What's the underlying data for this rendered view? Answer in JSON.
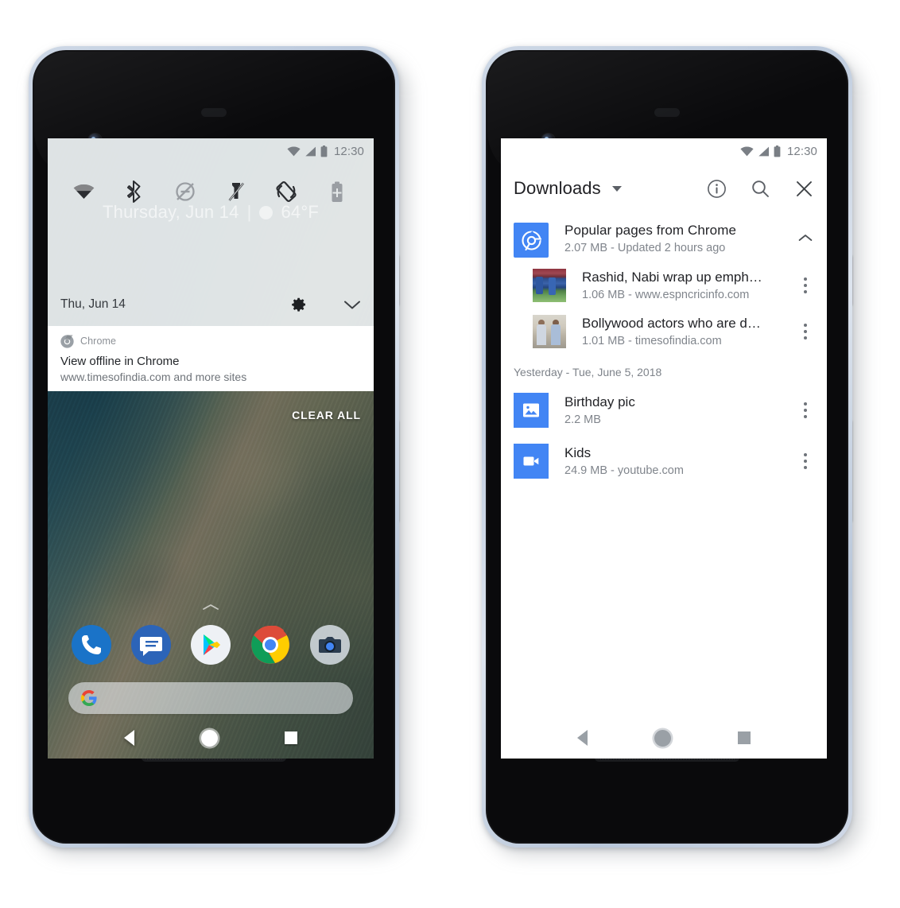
{
  "colors": {
    "accent_blue": "#4285f4",
    "chrome_tile_blue": "#4285f4",
    "status_gray": "#7a7f85",
    "power_button_teal": "#3ec7a6",
    "shade_gray": "#e5e9ea",
    "text_primary": "#222327",
    "text_secondary": "#80858c"
  },
  "left_phone": {
    "status_bar": {
      "time": "12:30",
      "icons": [
        "wifi-icon",
        "signal-icon",
        "battery-icon"
      ]
    },
    "quick_settings": {
      "tiles": [
        {
          "name": "wifi-tile",
          "icon": "wifi-icon",
          "state": "on"
        },
        {
          "name": "bluetooth-tile",
          "icon": "bluetooth-icon",
          "state": "on"
        },
        {
          "name": "do-not-disturb-tile",
          "icon": "do-not-disturb-off-icon",
          "state": "off"
        },
        {
          "name": "flashlight-tile",
          "icon": "flashlight-off-icon",
          "state": "off"
        },
        {
          "name": "auto-rotate-tile",
          "icon": "auto-rotate-icon",
          "state": "on"
        },
        {
          "name": "battery-saver-tile",
          "icon": "battery-saver-icon",
          "state": "off"
        }
      ],
      "date": "Thu, Jun 14",
      "settings_icon": "gear-icon",
      "expand_icon": "chevron-down-icon"
    },
    "widget_ghost": {
      "date": "Thursday, Jun 14",
      "separator": "|",
      "temperature": "64°F",
      "weather_icon": "sun-icon"
    },
    "notification": {
      "app_name": "Chrome",
      "app_icon": "chrome-icon",
      "title": "View offline in Chrome",
      "subtitle": "www.timesofindia.com and more sites"
    },
    "clear_all_label": "CLEAR ALL",
    "dock": [
      {
        "name": "phone-app-icon",
        "label": "Phone"
      },
      {
        "name": "messages-app-icon",
        "label": "Messages"
      },
      {
        "name": "play-store-app-icon",
        "label": "Play Store"
      },
      {
        "name": "chrome-app-icon",
        "label": "Chrome"
      },
      {
        "name": "camera-app-icon",
        "label": "Camera"
      }
    ],
    "search_bar": {
      "icon": "google-g-icon",
      "placeholder": ""
    },
    "nav_bar": {
      "back": "back-icon",
      "home": "home-icon",
      "recents": "recents-icon"
    }
  },
  "right_phone": {
    "status_bar": {
      "time": "12:30",
      "icons": [
        "wifi-icon",
        "signal-icon",
        "battery-icon"
      ]
    },
    "app_bar": {
      "title": "Downloads",
      "dropdown_icon": "caret-down-icon",
      "actions": [
        {
          "name": "info-button",
          "icon": "info-icon"
        },
        {
          "name": "search-button",
          "icon": "search-icon"
        },
        {
          "name": "close-button",
          "icon": "close-icon"
        }
      ]
    },
    "group": {
      "icon": "chrome-icon",
      "title": "Popular pages from Chrome",
      "subtitle": "2.07 MB - Updated 2 hours ago",
      "collapse_icon": "chevron-up-icon",
      "items": [
        {
          "thumbnail": "cricket-match-thumbnail",
          "title": "Rashid, Nabi wrap up emph…",
          "subtitle": "1.06 MB - www.espncricinfo.com",
          "menu_icon": "kebab-menu-icon"
        },
        {
          "thumbnail": "handshake-photo-thumbnail",
          "title": "Bollywood actors who are d…",
          "subtitle": "1.01 MB - timesofindia.com",
          "menu_icon": "kebab-menu-icon"
        }
      ]
    },
    "date_header": "Yesterday - Tue, June 5, 2018",
    "files": [
      {
        "icon": "image-file-icon",
        "title": "Birthday pic",
        "subtitle": "2.2 MB",
        "menu_icon": "kebab-menu-icon"
      },
      {
        "icon": "video-file-icon",
        "title": "Kids",
        "subtitle": "24.9 MB - youtube.com",
        "menu_icon": "kebab-menu-icon"
      }
    ],
    "nav_bar": {
      "back": "back-icon",
      "home": "home-icon",
      "recents": "recents-icon"
    }
  }
}
